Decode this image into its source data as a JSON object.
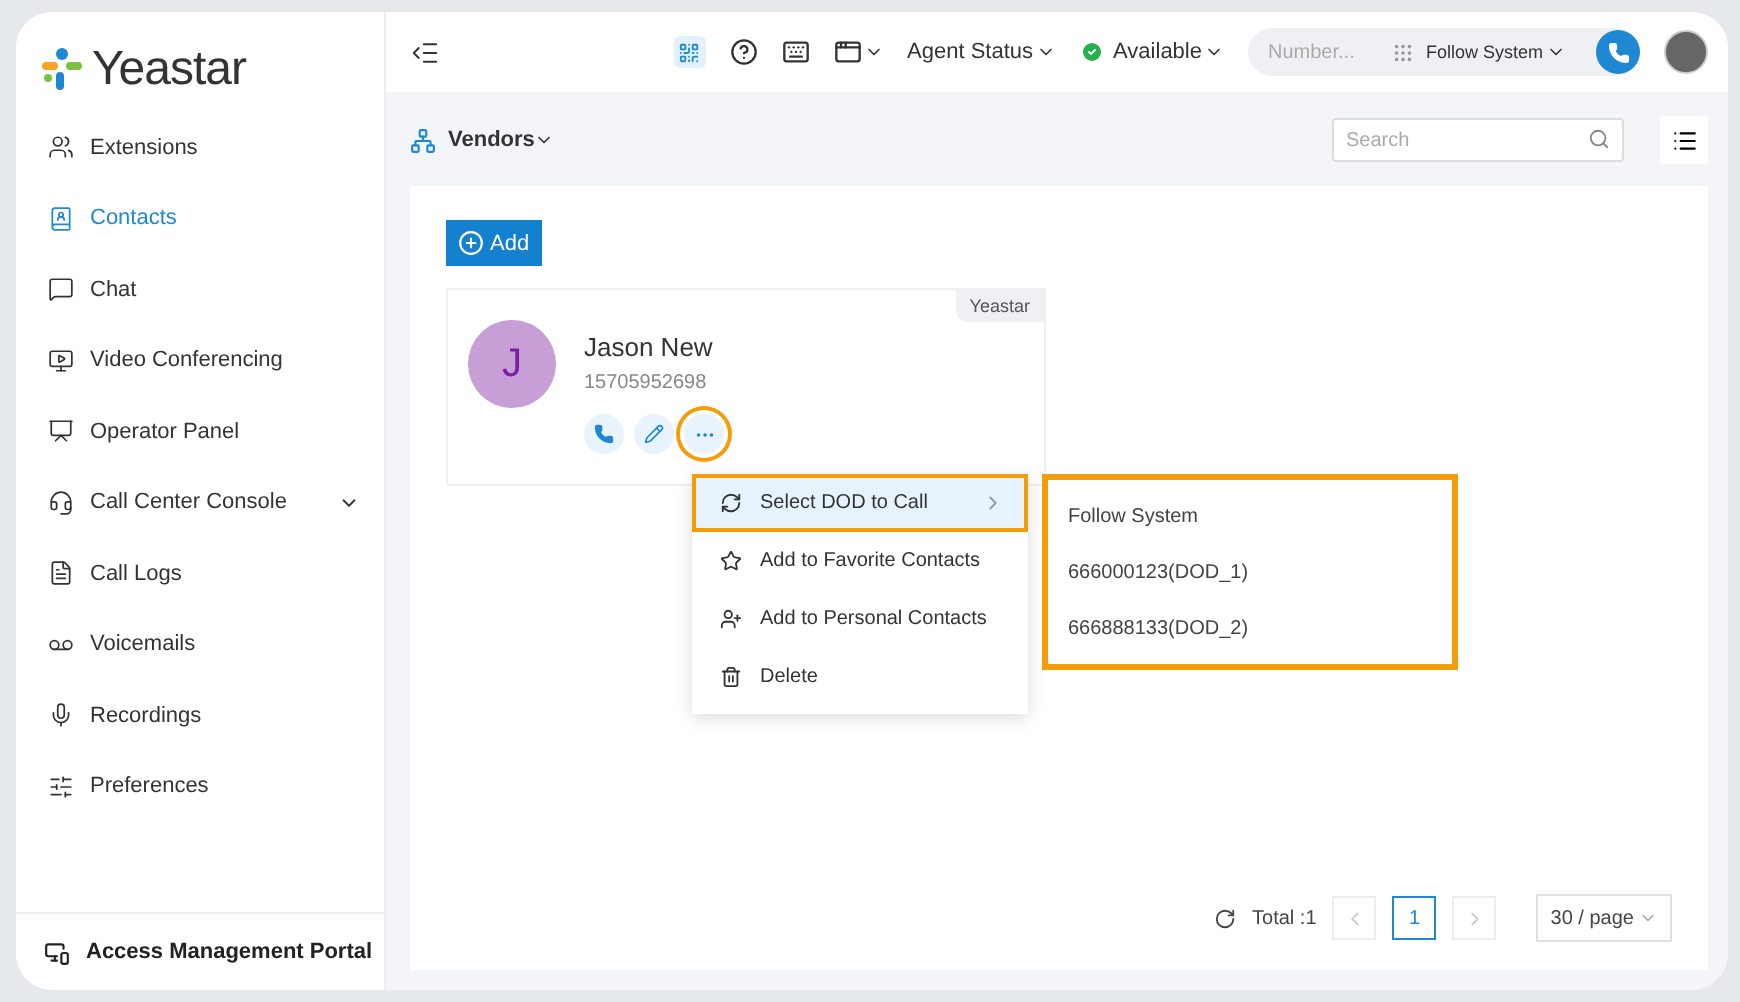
{
  "brand": {
    "name": "Yeastar"
  },
  "sidebar": {
    "items": [
      {
        "label": "Extensions",
        "selected": false
      },
      {
        "label": "Contacts",
        "selected": true
      },
      {
        "label": "Chat",
        "selected": false
      },
      {
        "label": "Video Conferencing",
        "selected": false
      },
      {
        "label": "Operator Panel",
        "selected": false
      },
      {
        "label": "Call Center Console",
        "selected": false,
        "expanded": false
      },
      {
        "label": "Call Logs",
        "selected": false
      },
      {
        "label": "Voicemails",
        "selected": false
      },
      {
        "label": "Recordings",
        "selected": false
      },
      {
        "label": "Preferences",
        "selected": false
      }
    ],
    "footer": "Access Management Portal"
  },
  "topbar": {
    "agent_status": "Agent Status",
    "presence": "Available",
    "number_placeholder": "Number...",
    "dod": "Follow System"
  },
  "header": {
    "group": "Vendors",
    "search_placeholder": "Search"
  },
  "add_button": "Add",
  "contact": {
    "initial": "J",
    "name": "Jason New",
    "number": "15705952698",
    "tag": "Yeastar",
    "more_highlighted": true
  },
  "menu": {
    "items": [
      {
        "label": "Select DOD to Call",
        "kind": "submenu",
        "selected": true
      },
      {
        "label": "Add to Favorite Contacts",
        "kind": "action",
        "selected": false
      },
      {
        "label": "Add to Personal Contacts",
        "kind": "action",
        "selected": false
      },
      {
        "label": "Delete",
        "kind": "action",
        "selected": false
      }
    ]
  },
  "submenu": {
    "items": [
      "Follow System",
      "666000123(DOD_1)",
      "666888133(DOD_2)"
    ]
  },
  "pagination": {
    "total": "Total :1",
    "pages": [
      {
        "label": "1",
        "selected": true
      }
    ],
    "page_size": "30 / page"
  }
}
